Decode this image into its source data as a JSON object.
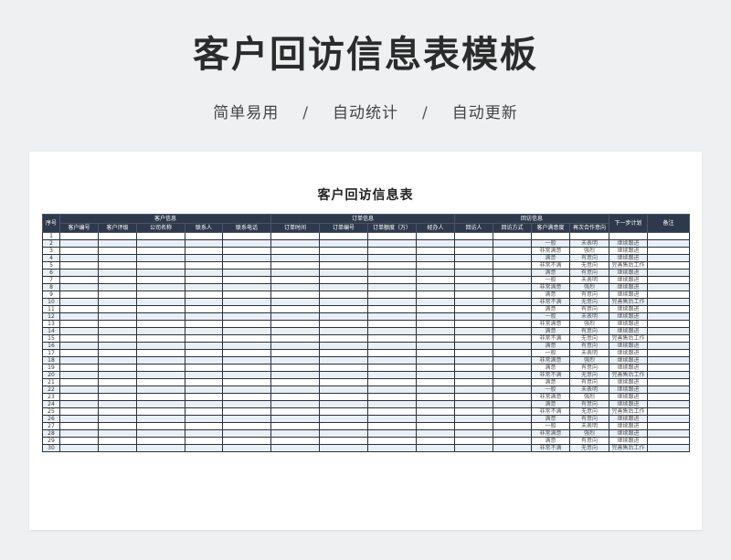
{
  "page": {
    "title": "客户回访信息表模板",
    "tags": [
      "简单易用",
      "自动统计",
      "自动更新"
    ],
    "separator": "/"
  },
  "sheet": {
    "title": "客户回访信息表",
    "headers": {
      "seq": "序号",
      "groups": [
        "客户信息",
        "订单信息",
        "回访信息"
      ],
      "next_plan": "下一步计划",
      "remark": "备注",
      "sub": [
        "客户编号",
        "客户评级",
        "公司名称",
        "联系人",
        "联系电话",
        "订单时间",
        "订单编号",
        "订单额度（万）",
        "经办人",
        "回访人",
        "回访方式",
        "客户满意度",
        "再次合作意向"
      ]
    },
    "rows": [
      {
        "no": "1",
        "satisfaction": "",
        "intent": "",
        "plan": ""
      },
      {
        "no": "2",
        "satisfaction": "一般",
        "intent": "未表明",
        "plan": "继续跟进"
      },
      {
        "no": "3",
        "satisfaction": "非常满意",
        "intent": "强烈",
        "plan": "继续跟进"
      },
      {
        "no": "4",
        "satisfaction": "满意",
        "intent": "有意向",
        "plan": "继续跟进"
      },
      {
        "no": "5",
        "satisfaction": "非常不满",
        "intent": "无意向",
        "plan": "完善售后工作"
      },
      {
        "no": "6",
        "satisfaction": "满意",
        "intent": "有意向",
        "plan": "继续跟进"
      },
      {
        "no": "7",
        "satisfaction": "一般",
        "intent": "未表明",
        "plan": "继续跟进"
      },
      {
        "no": "8",
        "satisfaction": "非常满意",
        "intent": "强烈",
        "plan": "继续跟进"
      },
      {
        "no": "9",
        "satisfaction": "满意",
        "intent": "有意向",
        "plan": "继续跟进"
      },
      {
        "no": "10",
        "satisfaction": "非常不满",
        "intent": "无意向",
        "plan": "完善售后工作"
      },
      {
        "no": "11",
        "satisfaction": "满意",
        "intent": "有意向",
        "plan": "继续跟进"
      },
      {
        "no": "12",
        "satisfaction": "一般",
        "intent": "未表明",
        "plan": "继续跟进"
      },
      {
        "no": "13",
        "satisfaction": "非常满意",
        "intent": "强烈",
        "plan": "继续跟进"
      },
      {
        "no": "14",
        "satisfaction": "满意",
        "intent": "有意向",
        "plan": "继续跟进"
      },
      {
        "no": "15",
        "satisfaction": "非常不满",
        "intent": "无意向",
        "plan": "完善售后工作"
      },
      {
        "no": "16",
        "satisfaction": "满意",
        "intent": "有意向",
        "plan": "继续跟进"
      },
      {
        "no": "17",
        "satisfaction": "一般",
        "intent": "未表明",
        "plan": "继续跟进"
      },
      {
        "no": "18",
        "satisfaction": "非常满意",
        "intent": "强烈",
        "plan": "继续跟进"
      },
      {
        "no": "19",
        "satisfaction": "满意",
        "intent": "有意向",
        "plan": "继续跟进"
      },
      {
        "no": "20",
        "satisfaction": "非常不满",
        "intent": "无意向",
        "plan": "完善售后工作"
      },
      {
        "no": "21",
        "satisfaction": "满意",
        "intent": "有意向",
        "plan": "继续跟进"
      },
      {
        "no": "22",
        "satisfaction": "一般",
        "intent": "未表明",
        "plan": "继续跟进"
      },
      {
        "no": "23",
        "satisfaction": "非常满意",
        "intent": "强烈",
        "plan": "继续跟进"
      },
      {
        "no": "24",
        "satisfaction": "满意",
        "intent": "有意向",
        "plan": "继续跟进"
      },
      {
        "no": "25",
        "satisfaction": "非常不满",
        "intent": "无意向",
        "plan": "完善售后工作"
      },
      {
        "no": "26",
        "satisfaction": "满意",
        "intent": "有意向",
        "plan": "继续跟进"
      },
      {
        "no": "27",
        "satisfaction": "一般",
        "intent": "未表明",
        "plan": "继续跟进"
      },
      {
        "no": "28",
        "satisfaction": "非常满意",
        "intent": "强烈",
        "plan": "继续跟进"
      },
      {
        "no": "29",
        "satisfaction": "满意",
        "intent": "有意向",
        "plan": "继续跟进"
      },
      {
        "no": "30",
        "satisfaction": "非常不满",
        "intent": "无意向",
        "plan": "完善售后工作"
      }
    ]
  },
  "colors": {
    "header_bg": "#2e3a4c",
    "stripe": "#e9eff4",
    "page_bg": "#eef0f2"
  }
}
